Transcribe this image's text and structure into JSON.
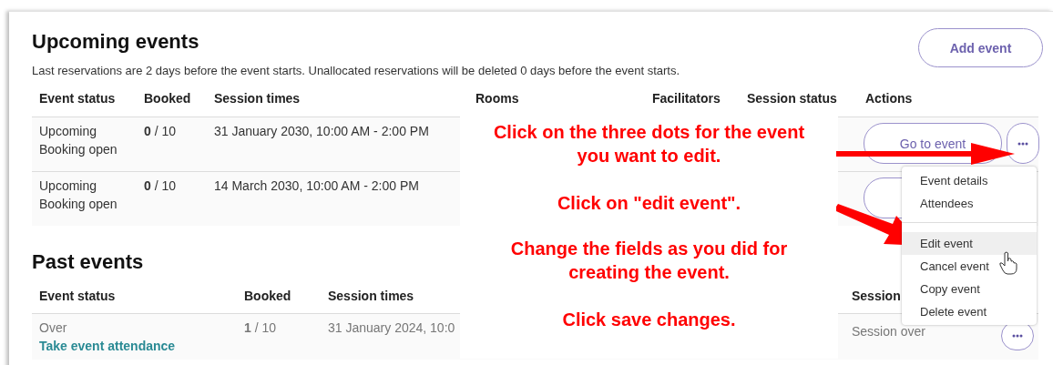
{
  "upcoming": {
    "title": "Upcoming events",
    "description": "Last reservations are 2 days before the event starts. Unallocated reservations will be deleted 0 days before the event starts.",
    "add_button": "Add event",
    "columns": [
      "Event status",
      "Booked",
      "Session times",
      "Rooms",
      "Facilitators",
      "Session status",
      "Actions"
    ],
    "rows": [
      {
        "status": [
          "Upcoming",
          "Booking open"
        ],
        "booked": "**0** / 10",
        "session_times": "31 January 2030, 10:00 AM - 2:00 PM",
        "action": "Go to event",
        "more_button": true
      },
      {
        "status": [
          "Upcoming",
          "Booking open"
        ],
        "booked": "**0** / 10",
        "session_times": "14 March 2030, 10:00 AM - 2:00 PM"
      }
    ]
  },
  "past": {
    "title": "Past events",
    "columns": [
      "Event status",
      "Booked",
      "Session times",
      "Session"
    ],
    "rows": [
      {
        "status": "Over",
        "link": "Take event attendance",
        "booked": "**1** / 10",
        "session_times": "31 January 2024, 10:0",
        "session_status": "Session over",
        "more_button": true
      }
    ]
  },
  "menu": {
    "groups": [
      {
        "items": [
          {
            "label": "Event details",
            "selected": false
          },
          {
            "label": "Attendees",
            "selected": false
          }
        ]
      },
      {
        "items": [
          {
            "label": "Edit event",
            "selected": true
          },
          {
            "label": "Cancel event",
            "selected": false
          },
          {
            "label": "Copy event",
            "selected": false
          },
          {
            "label": "Delete event",
            "selected": false
          }
        ]
      }
    ]
  },
  "annotations": [
    "Click on the three dots for the event you want to edit.",
    "Click on \"edit event\".",
    "Change the fields as you did for creating the event.",
    "Click save changes."
  ]
}
